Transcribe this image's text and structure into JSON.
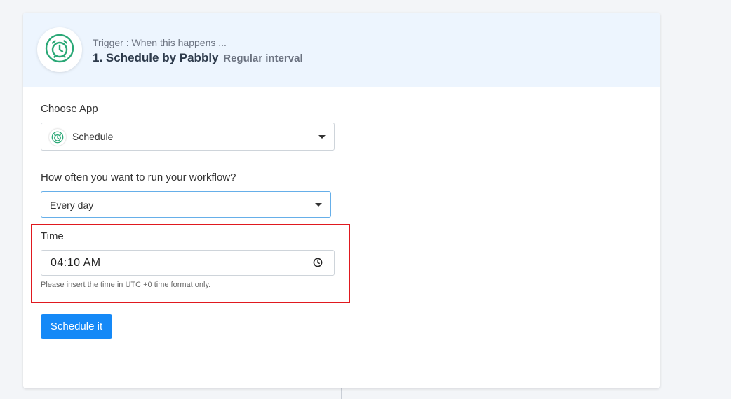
{
  "header": {
    "subtitle": "Trigger : When this happens ...",
    "title": "1. Schedule by Pabbly",
    "title_suffix": "Regular interval",
    "app_icon": "alarm-clock-icon"
  },
  "form": {
    "choose_app": {
      "label": "Choose App",
      "value": "Schedule",
      "icon": "alarm-clock-icon"
    },
    "frequency": {
      "label": "How often you want to run your workflow?",
      "value": "Every day"
    },
    "time": {
      "label": "Time",
      "value": "04:10 AM",
      "help": "Please insert the time in UTC +0 time format only."
    },
    "submit_label": "Schedule it"
  },
  "colors": {
    "accent": "#1589f7",
    "brand_green": "#2aa876",
    "highlight": "#e0191f",
    "header_bg": "#edf5fe"
  }
}
